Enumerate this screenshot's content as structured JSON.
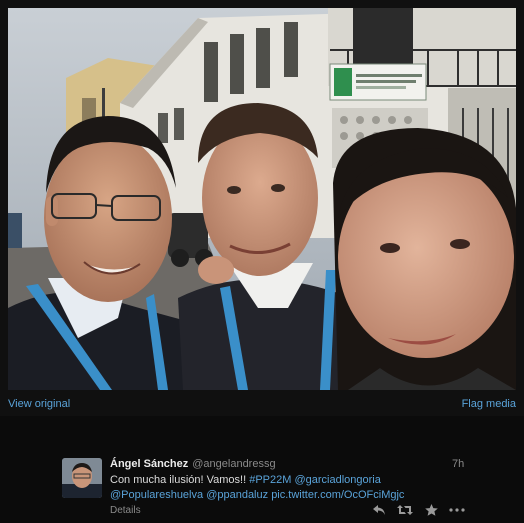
{
  "links": {
    "view_original": "View original",
    "flag_media": "Flag media"
  },
  "tweet": {
    "name": "Ángel Sánchez",
    "handle": "@angelandressg",
    "time": "7h",
    "text_line1_prefix": "Con mucha ilusión! Vamos!! ",
    "hashtag": "#PP22M",
    "mention1": "@garciadlongoria",
    "mention2": "@Populareshuelva",
    "mention3": "@ppandaluz",
    "media_link": "pic.twitter.com/OcOFciMgjc",
    "details": "Details"
  },
  "photo": {
    "sign_text": "Colegio de Educación Infantil y Primaria"
  },
  "icons": {
    "reply": "reply-icon",
    "retweet": "retweet-icon",
    "favorite": "star-icon",
    "more": "more-icon"
  },
  "colors": {
    "link": "#5aa3d9",
    "background": "#0b0b0b",
    "muted": "#8a8a8a"
  }
}
